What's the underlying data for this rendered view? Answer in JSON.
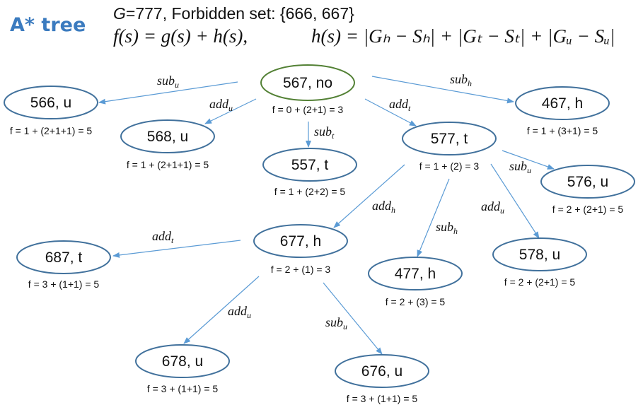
{
  "title": "A* tree",
  "header": {
    "goal_prefix": "G",
    "goal_text": "=777, Forbidden set: {666, 667}",
    "formula_f": "f(s) = g(s) + h(s),",
    "formula_h": "h(s) = |Gₕ − Sₕ| + |Gₜ − Sₜ| + |Gᵤ − Sᵤ|"
  },
  "colors": {
    "title": "#3b7bbf",
    "node_border": "#41719c",
    "root_border": "#538135",
    "edge": "#5b9bd5"
  },
  "nodes": [
    {
      "id": "n567",
      "label": "567, no",
      "f": "f = 0 + (2+1) = 3",
      "root": true
    },
    {
      "id": "n566",
      "label": "566, u",
      "f": "f = 1 + (2+1+1) = 5"
    },
    {
      "id": "n568",
      "label": "568, u",
      "f": "f = 1 + (2+1+1) = 5"
    },
    {
      "id": "n557",
      "label": "557, t",
      "f": "f = 1 + (2+2) = 5"
    },
    {
      "id": "n577",
      "label": "577, t",
      "f": "f = 1 + (2) = 3"
    },
    {
      "id": "n467",
      "label": "467, h",
      "f": "f = 1 + (3+1) = 5"
    },
    {
      "id": "n576",
      "label": "576, u",
      "f": "f = 2 + (2+1) = 5"
    },
    {
      "id": "n677",
      "label": "677, h",
      "f": "f = 2 + (1) = 3"
    },
    {
      "id": "n477",
      "label": "477, h",
      "f": "f = 2 + (3) = 5"
    },
    {
      "id": "n578",
      "label": "578, u",
      "f": "f = 2 + (2+1) = 5"
    },
    {
      "id": "n687",
      "label": "687, t",
      "f": "f = 3 + (1+1) = 5"
    },
    {
      "id": "n678",
      "label": "678, u",
      "f": "f = 3 + (1+1) = 5"
    },
    {
      "id": "n676",
      "label": "676, u",
      "f": "f = 3 + (1+1) = 5"
    }
  ],
  "edges": [
    {
      "from": "n567",
      "to": "n566",
      "op": "sub",
      "sub": "u"
    },
    {
      "from": "n567",
      "to": "n568",
      "op": "add",
      "sub": "u"
    },
    {
      "from": "n567",
      "to": "n557",
      "op": "sub",
      "sub": "t"
    },
    {
      "from": "n567",
      "to": "n577",
      "op": "add",
      "sub": "t"
    },
    {
      "from": "n567",
      "to": "n467",
      "op": "sub",
      "sub": "h"
    },
    {
      "from": "n577",
      "to": "n576",
      "op": "sub",
      "sub": "u"
    },
    {
      "from": "n577",
      "to": "n677",
      "op": "add",
      "sub": "h"
    },
    {
      "from": "n577",
      "to": "n477",
      "op": "sub",
      "sub": "h"
    },
    {
      "from": "n577",
      "to": "n578",
      "op": "add",
      "sub": "u"
    },
    {
      "from": "n677",
      "to": "n687",
      "op": "add",
      "sub": "t"
    },
    {
      "from": "n677",
      "to": "n678",
      "op": "add",
      "sub": "u"
    },
    {
      "from": "n677",
      "to": "n676",
      "op": "sub",
      "sub": "u"
    }
  ]
}
